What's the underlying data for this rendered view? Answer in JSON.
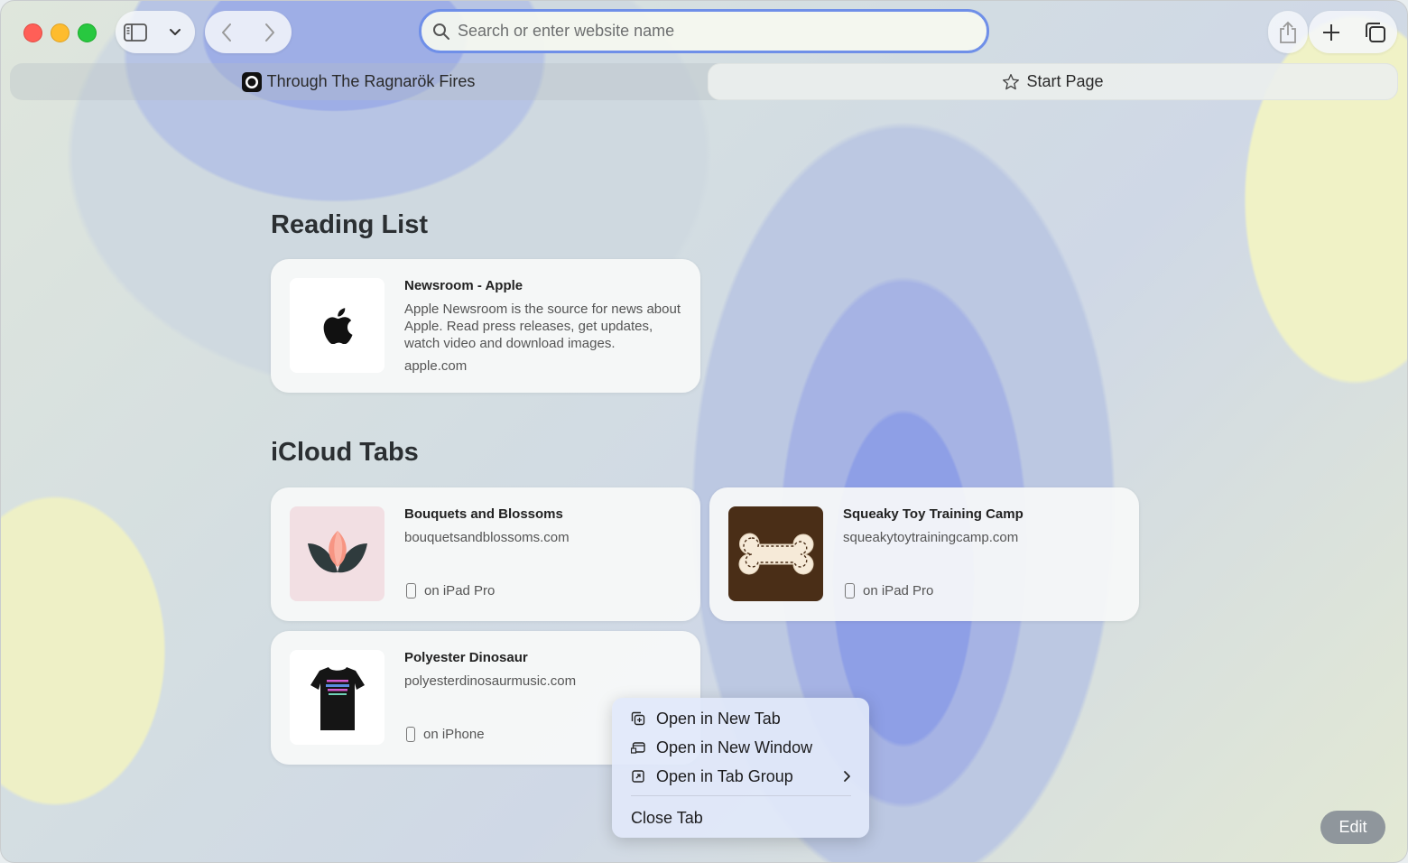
{
  "toolbar": {
    "search_placeholder": "Search or enter website name"
  },
  "tabs": [
    {
      "label": "Through The Ragnarök Fires",
      "active": false
    },
    {
      "label": "Start Page",
      "active": true
    }
  ],
  "reading_list": {
    "title": "Reading List",
    "items": [
      {
        "title": "Newsroom - Apple",
        "description": "Apple Newsroom is the source for news about Apple. Read press releases, get updates, watch video and download images.",
        "url": "apple.com"
      }
    ]
  },
  "icloud_tabs": {
    "title": "iCloud Tabs",
    "items": [
      {
        "title": "Bouquets and Blossoms",
        "url": "bouquetsandblossoms.com",
        "device": "on iPad Pro"
      },
      {
        "title": "Squeaky Toy Training Camp",
        "url": "squeakytoytrainingcamp.com",
        "device": "on iPad Pro"
      },
      {
        "title": "Polyester Dinosaur",
        "url": "polyesterdinosaurmusic.com",
        "device": "on iPhone"
      }
    ]
  },
  "context_menu": {
    "items": [
      "Open in New Tab",
      "Open in New Window",
      "Open in Tab Group",
      "Close Tab"
    ]
  },
  "edit_label": "Edit",
  "colors": {
    "close": "#ff5f57",
    "minimize": "#febc2e",
    "zoom": "#28c840",
    "search_border": "#6f8fe8",
    "bone_bg": "#4a2e17",
    "flower_bg": "#f2dfe3"
  }
}
